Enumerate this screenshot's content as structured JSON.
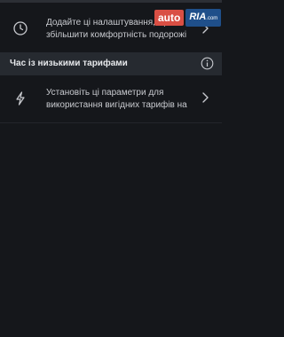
{
  "comfort_row": {
    "text_line1": "Додайте ці налаштування, щоб",
    "text_line2": "збільшити комфортність подорожі",
    "icon": "clock-icon"
  },
  "low_tariff_section": {
    "title": "Час із низькими тарифами",
    "info_icon": "info-icon"
  },
  "low_tariff_row": {
    "text_line1": "Установіть ці параметри для",
    "text_line2": "використання вигідних тарифів на",
    "icon": "lightning-icon"
  },
  "watermark": {
    "auto": "auto",
    "ria": "RIA",
    "ria_tail": ".com"
  }
}
